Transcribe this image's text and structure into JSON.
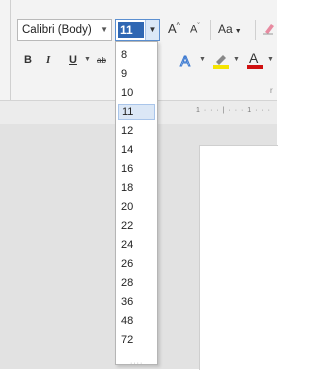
{
  "ribbon": {
    "font_name": "Calibri (Body)",
    "font_size": "11",
    "grow_label": "A",
    "shrink_label": "A",
    "case_label": "Aa",
    "bold_label": "B",
    "italic_label": "I",
    "underline_label": "U",
    "strikethrough_label": "ab",
    "group_hint": "r",
    "colors": {
      "selected_size_bg": "#2f67b3",
      "highlight": "#f5e400",
      "font_color": "#d01010"
    }
  },
  "ruler": {
    "marks": "1 · · · | · · · 1 · · ·"
  },
  "dropdown": {
    "sizes": [
      "8",
      "9",
      "10",
      "11",
      "12",
      "14",
      "16",
      "18",
      "20",
      "22",
      "24",
      "26",
      "28",
      "36",
      "48",
      "72"
    ],
    "selected": "11"
  }
}
